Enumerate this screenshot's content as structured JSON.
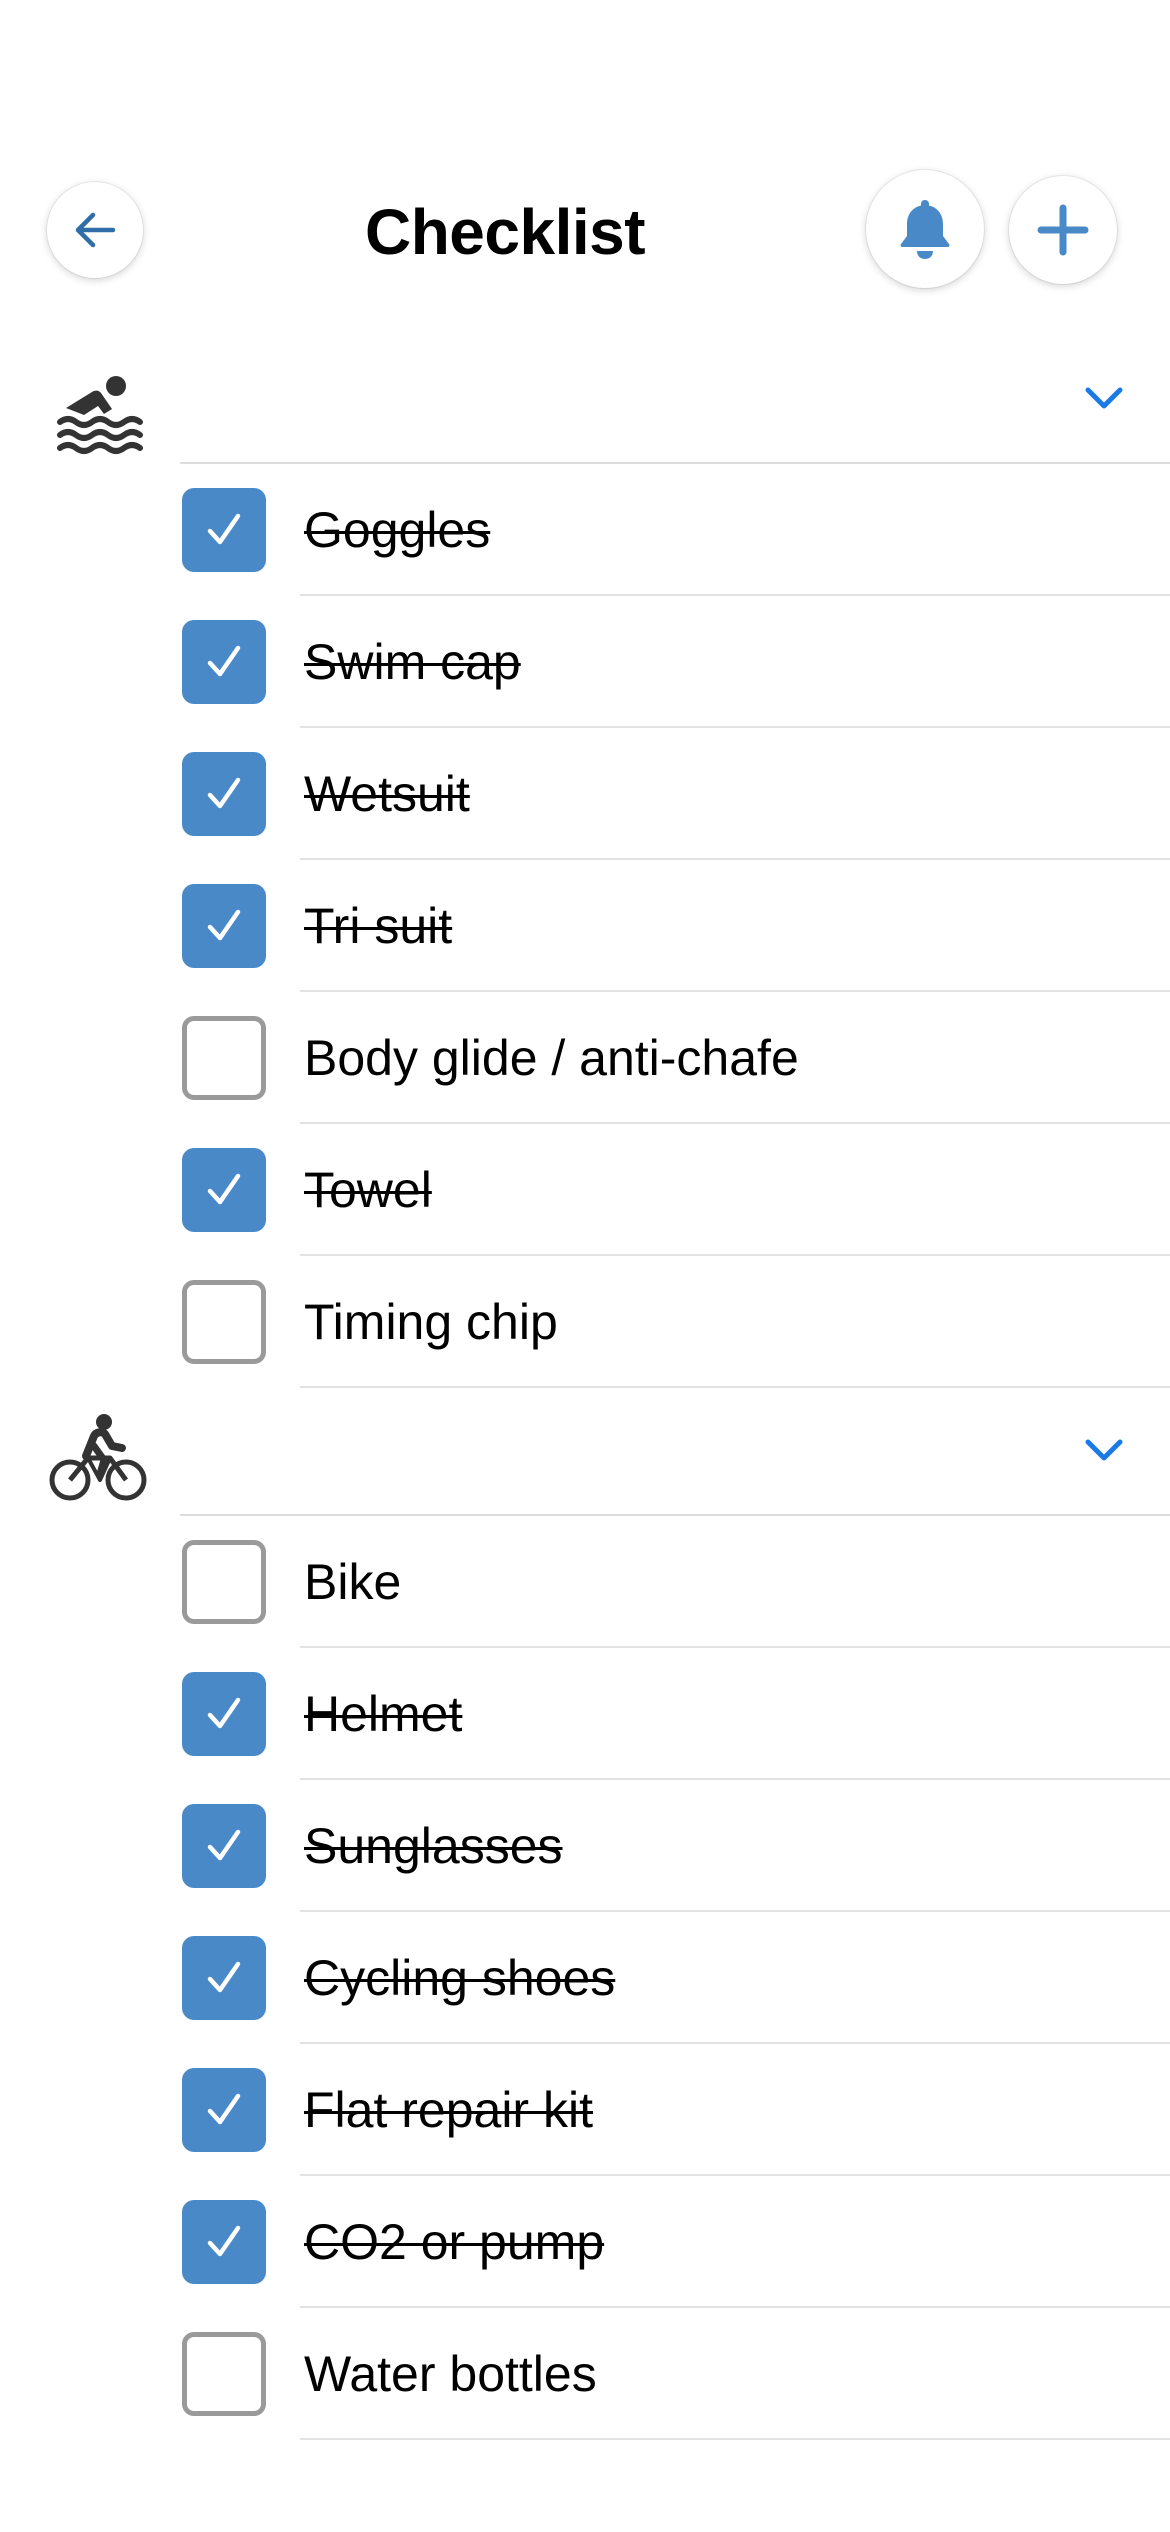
{
  "header": {
    "title": "Checklist",
    "back_icon": "arrow-left-icon",
    "bell_icon": "bell-icon",
    "add_icon": "plus-icon"
  },
  "colors": {
    "accent": "#4a89c8",
    "chevron": "#1a7ae6",
    "unchecked_border": "#9a9a9a",
    "divider": "#dcdcdc"
  },
  "sections": [
    {
      "icon": "swimming-icon",
      "expanded": true,
      "items": [
        {
          "label": "Goggles",
          "checked": true
        },
        {
          "label": "Swim cap",
          "checked": true
        },
        {
          "label": "Wetsuit",
          "checked": true
        },
        {
          "label": "Tri suit",
          "checked": true
        },
        {
          "label": "Body glide / anti-chafe",
          "checked": false
        },
        {
          "label": "Towel",
          "checked": true
        },
        {
          "label": "Timing chip",
          "checked": false
        }
      ]
    },
    {
      "icon": "cycling-icon",
      "expanded": true,
      "items": [
        {
          "label": "Bike",
          "checked": false
        },
        {
          "label": "Helmet",
          "checked": true
        },
        {
          "label": "Sunglasses",
          "checked": true
        },
        {
          "label": "Cycling shoes",
          "checked": true
        },
        {
          "label": "Flat repair kit",
          "checked": true
        },
        {
          "label": "CO2 or pump",
          "checked": true
        },
        {
          "label": "Water bottles",
          "checked": false
        }
      ]
    }
  ]
}
